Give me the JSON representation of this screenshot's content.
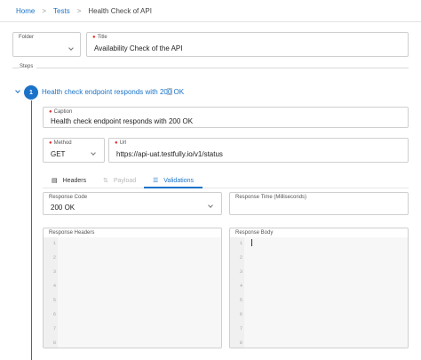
{
  "breadcrumb": {
    "home": "Home",
    "tests": "Tests",
    "current": "Health Check of API",
    "separator": ">"
  },
  "folder": {
    "label": "Folder",
    "value": ""
  },
  "title_field": {
    "label": "Title",
    "value": "Availability Check of the API"
  },
  "steps_label": "Steps",
  "step": {
    "number": "1",
    "title": "Health check endpoint responds with 200 OK",
    "caption": {
      "label": "Caption",
      "value": "Health check endpoint responds with 200 OK"
    },
    "method": {
      "label": "Method",
      "value": "GET"
    },
    "url": {
      "label": "Url",
      "value": "https://api-uat.testfully.io/v1/status"
    },
    "tabs": [
      {
        "label": "Headers",
        "icon": "headers-icon",
        "state": "normal"
      },
      {
        "label": "Payload",
        "icon": "payload-icon",
        "state": "disabled"
      },
      {
        "label": "Validations",
        "icon": "validations-icon",
        "state": "active"
      }
    ],
    "response_code": {
      "label": "Response Code",
      "value": "200 OK"
    },
    "response_time": {
      "label": "Response Time (Milliseconds)",
      "value": ""
    },
    "response_headers": {
      "label": "Response Headers",
      "line_numbers": [
        "1",
        "2",
        "3",
        "4",
        "5",
        "6",
        "7",
        "8"
      ]
    },
    "response_body": {
      "label": "Response Body",
      "line_numbers": [
        "1",
        "2",
        "3",
        "4",
        "5",
        "6",
        "7",
        "8"
      ]
    }
  },
  "colors": {
    "accent": "#1a73c8",
    "required": "#dd3333"
  }
}
